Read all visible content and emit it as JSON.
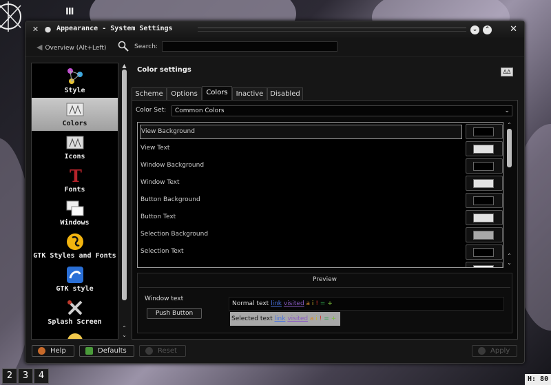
{
  "desktop": {
    "glyph": "III",
    "pager": [
      "2",
      "3",
      "4"
    ],
    "hud_text": "H: 80"
  },
  "window": {
    "title": "Appearance - System Settings"
  },
  "toolbar": {
    "overview_label": "Overview (Alt+Left)",
    "search_label": "Search:",
    "search_value": ""
  },
  "sidebar": {
    "items": [
      {
        "label": "Style",
        "icon": "style-icon"
      },
      {
        "label": "Colors",
        "icon": "colors-icon",
        "active": true
      },
      {
        "label": "Icons",
        "icon": "icons-icon"
      },
      {
        "label": "Fonts",
        "icon": "fonts-icon"
      },
      {
        "label": "Windows",
        "icon": "windows-icon"
      },
      {
        "label": "GTK Styles and Fonts",
        "icon": "gtk-styles-icon"
      },
      {
        "label": "GTK style",
        "icon": "gtk-style-icon"
      },
      {
        "label": "Splash Screen",
        "icon": "splash-screen-icon"
      }
    ]
  },
  "page": {
    "title": "Color settings",
    "tabs": [
      "Scheme",
      "Options",
      "Colors",
      "Inactive",
      "Disabled"
    ],
    "active_tab": "Colors",
    "color_set_label": "Color Set:",
    "color_set_value": "Common Colors"
  },
  "color_rows": [
    {
      "label": "View Background",
      "color": "#000000"
    },
    {
      "label": "View Text",
      "color": "#e2e2e2"
    },
    {
      "label": "Window Background",
      "color": "#000000"
    },
    {
      "label": "Window Text",
      "color": "#e2e2e2"
    },
    {
      "label": "Button Background",
      "color": "#000000"
    },
    {
      "label": "Button Text",
      "color": "#e2e2e2"
    },
    {
      "label": "Selection Background",
      "color": "#a8a8a8"
    },
    {
      "label": "Selection Text",
      "color": "#000000"
    },
    {
      "label": "",
      "color": "#ffffff"
    }
  ],
  "preview": {
    "title": "Preview",
    "window_text": "Window text",
    "push_button": "Push Button",
    "normal_text": "Normal text",
    "selected_text": "Selected text",
    "link": "link",
    "visited": "visited",
    "sym_a": "a",
    "sym_i": "i",
    "sym_excl": "!",
    "sym_eq": "=",
    "sym_plus": "+"
  },
  "buttons": {
    "help": "Help",
    "defaults": "Defaults",
    "reset": "Reset",
    "apply": "Apply"
  },
  "colors": {
    "accent": "#a8a8a8",
    "link": "#4a72e0",
    "visited": "#8a5cc4"
  }
}
